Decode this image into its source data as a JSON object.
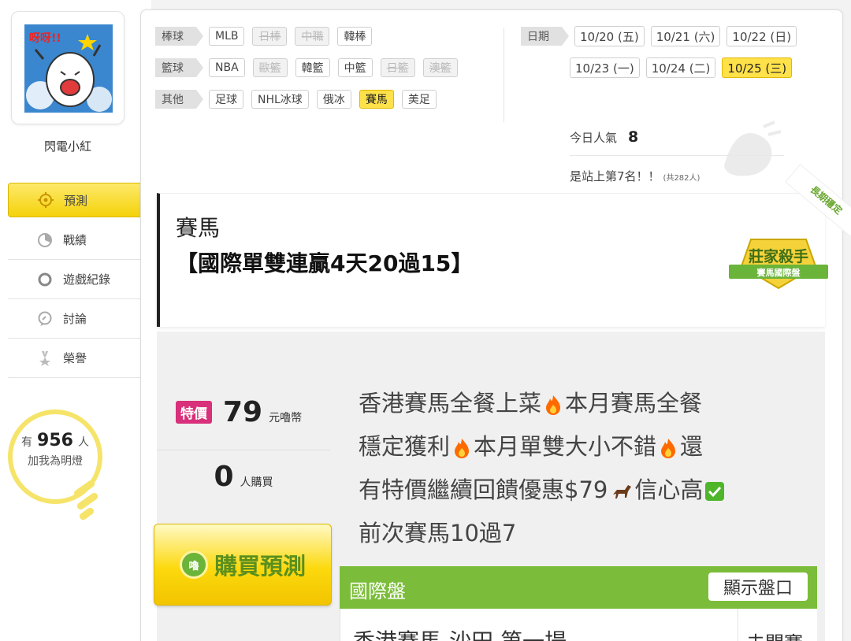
{
  "user": {
    "nickname": "閃電小紅",
    "avatar_caption": "呀呀!!"
  },
  "nav": [
    {
      "label": "預測",
      "icon": "target-icon",
      "active": true
    },
    {
      "label": "戰績",
      "icon": "chart-icon"
    },
    {
      "label": "遊戲紀錄",
      "icon": "circle-icon"
    },
    {
      "label": "討論",
      "icon": "chat-icon"
    },
    {
      "label": "榮譽",
      "icon": "medal-icon"
    }
  ],
  "fans": {
    "prefix": "有",
    "count": "956",
    "suffix": "人",
    "line2": "加我為明燈"
  },
  "filters": [
    {
      "head": "棒球",
      "items": [
        {
          "t": "MLB"
        },
        {
          "t": "日棒",
          "dis": true
        },
        {
          "t": "中職",
          "dis": true
        },
        {
          "t": "韓棒"
        }
      ]
    },
    {
      "head": "籃球",
      "items": [
        {
          "t": "NBA"
        },
        {
          "t": "歐籃",
          "dis": true
        },
        {
          "t": "韓籃"
        },
        {
          "t": "中籃"
        },
        {
          "t": "日籃",
          "dis": true
        },
        {
          "t": "澳籃",
          "dis": true
        }
      ]
    },
    {
      "head": "其他",
      "items": [
        {
          "t": "足球"
        },
        {
          "t": "NHL冰球"
        },
        {
          "t": "俄冰"
        },
        {
          "t": "賽馬",
          "on": true
        },
        {
          "t": "美足"
        }
      ]
    }
  ],
  "dates": {
    "head": "日期",
    "row1": [
      "10/20 (五)",
      "10/21 (六)",
      "10/22 (日)"
    ],
    "row2": [
      "10/23 (一)",
      "10/24 (二)",
      "10/25 (三)"
    ],
    "selected": "10/25 (三)"
  },
  "popularity": {
    "label": "今日人氣",
    "value": "8"
  },
  "rank": {
    "text": "是站上第7名！！",
    "note": "(共282人)"
  },
  "post": {
    "category": "賽馬",
    "title": "【國際單雙連贏4天20過15】",
    "badge_main": "莊家殺手",
    "badge_sub": "賽馬國際盤",
    "ribbon": "長期穩定"
  },
  "pricing": {
    "tag": "特價",
    "price": "79",
    "currency": "元嚕幣",
    "buyers": "0",
    "buyers_suffix": "人購買",
    "buy_label": "購買預測",
    "coin": "嚕"
  },
  "description": {
    "l1a": "香港賽馬全餐上菜",
    "l1b": "本月賽馬全餐",
    "l2a": "穩定獲利",
    "l2b": "本月單雙大小不錯",
    "l2c": "還",
    "l3a": "有特價繼續回饋優惠$79",
    "l3b": "信心高",
    "l4": "前次賽馬10過7"
  },
  "market": {
    "label": "國際盤",
    "button": "顯示盤口"
  },
  "race": {
    "name": "香港賽馬-沙田 第一場",
    "status": "未開賽"
  },
  "colors": {
    "accent_yellow": "#ffe14a",
    "green": "#7bbd3a",
    "pink": "#d8307a"
  }
}
